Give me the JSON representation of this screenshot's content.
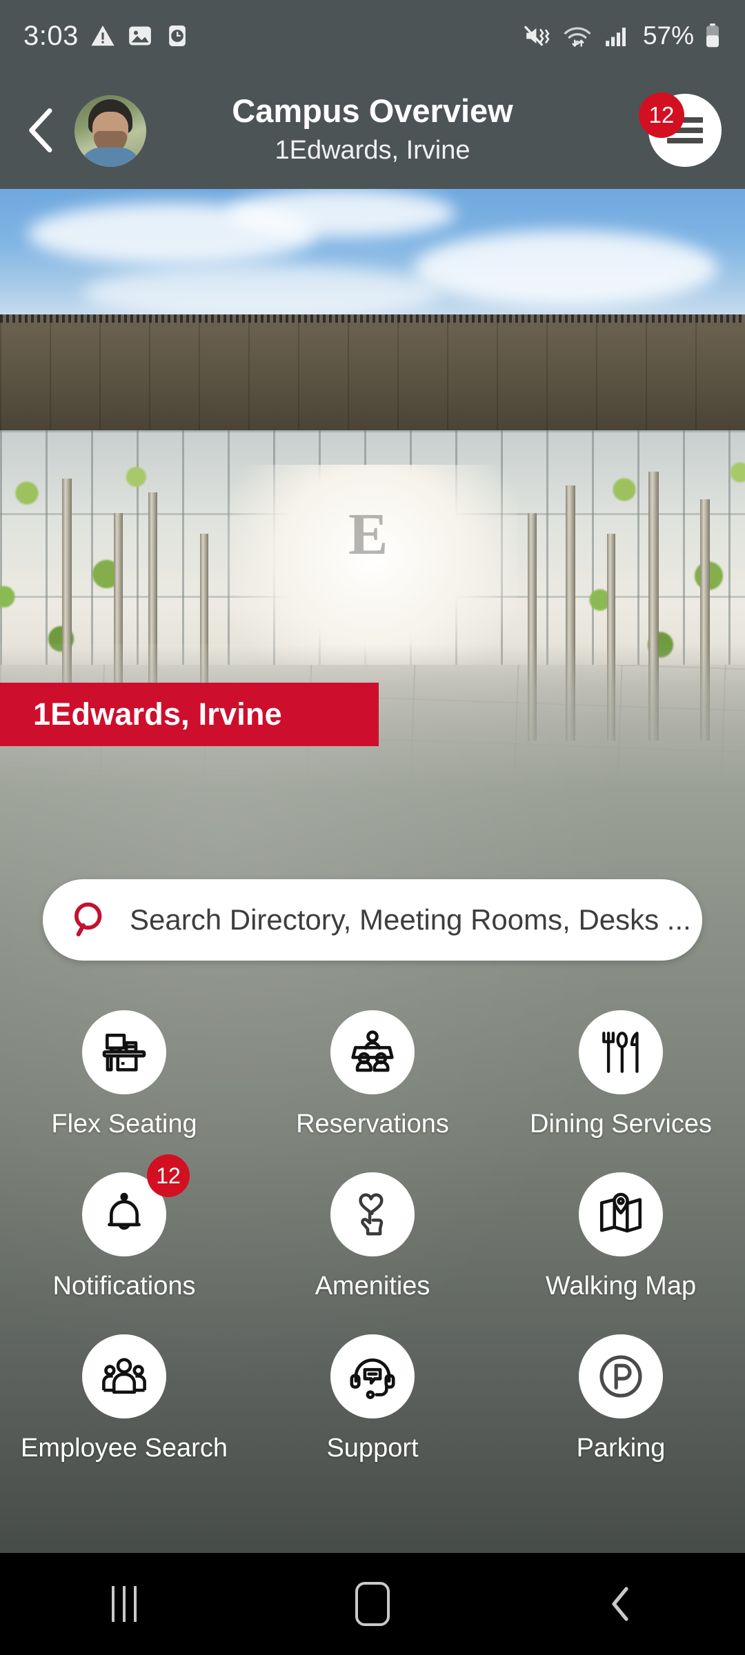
{
  "status_bar": {
    "time": "3:03",
    "battery_percent": "57%",
    "icons": [
      "warning-triangle-icon",
      "image-icon",
      "alarm-clock-icon",
      "mute-vibrate-icon",
      "wifi-icon",
      "cellular-signal-icon",
      "battery-icon"
    ]
  },
  "header": {
    "back_label": "Back",
    "avatar_name": "user-avatar",
    "title": "Campus Overview",
    "subtitle": "1Edwards, Irvine",
    "menu_badge": "12",
    "menu_label": "Menu"
  },
  "hero": {
    "location_banner": "1Edwards, Irvine",
    "building_logo": "E"
  },
  "search": {
    "placeholder": "Search Directory, Meeting Rooms, Desks ...",
    "value": "",
    "icon": "search-icon"
  },
  "colors": {
    "brand_red": "#ce0e2d",
    "badge_red": "#d21021",
    "header_grey": "#4d5456",
    "tile_white": "#ffffff"
  },
  "tiles": [
    {
      "label": "Flex Seating",
      "icon": "desk-workstation-icon",
      "badge": ""
    },
    {
      "label": "Reservations",
      "icon": "meeting-table-people-icon",
      "badge": ""
    },
    {
      "label": "Dining Services",
      "icon": "fork-spoon-knife-icon",
      "badge": ""
    },
    {
      "label": "Notifications",
      "icon": "bell-icon",
      "badge": "12"
    },
    {
      "label": "Amenities",
      "icon": "hand-tap-heart-icon",
      "badge": ""
    },
    {
      "label": "Walking Map",
      "icon": "folded-map-pin-icon",
      "badge": ""
    },
    {
      "label": "Employee Search",
      "icon": "people-group-icon",
      "badge": ""
    },
    {
      "label": "Support",
      "icon": "headset-chat-icon",
      "badge": ""
    },
    {
      "label": "Parking",
      "icon": "parking-p-icon",
      "badge": ""
    }
  ],
  "nav_bar": {
    "recents_label": "Recents",
    "home_label": "Home",
    "back_label": "Back"
  }
}
